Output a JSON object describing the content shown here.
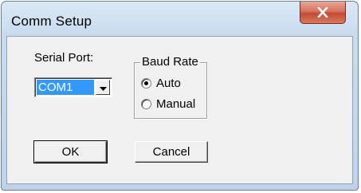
{
  "window": {
    "title": "Comm Setup",
    "close_icon": "close-x-icon"
  },
  "serial_port": {
    "label": "Serial Port:",
    "selected": "COM1",
    "arrow_icon": "chevron-down-icon"
  },
  "baud_rate": {
    "group_label": "Baud Rate",
    "options": [
      {
        "label": "Auto",
        "checked": true
      },
      {
        "label": "Manual",
        "checked": false
      }
    ]
  },
  "buttons": {
    "ok_label": "OK",
    "cancel_label": "Cancel"
  },
  "colors": {
    "selection": "#3399ff",
    "close_button": "#c44a34",
    "dialog_face": "#f0f0f0"
  }
}
